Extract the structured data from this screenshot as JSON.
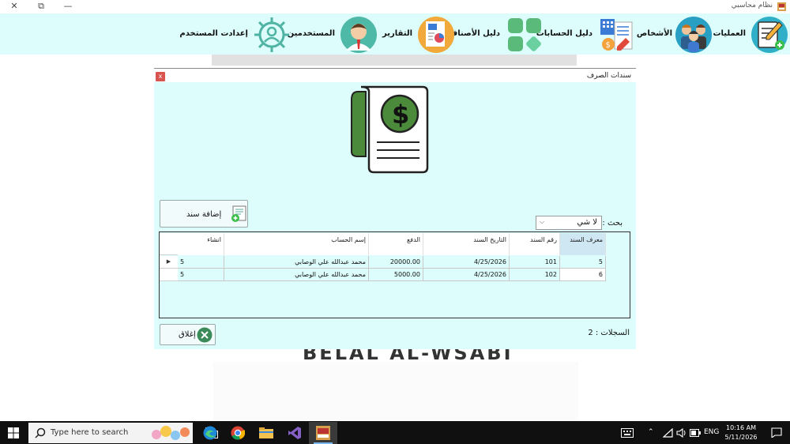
{
  "app": {
    "title": "نظام محاسبي",
    "window_controls": {
      "close": "✕",
      "restore": "⧉",
      "minimize": "—"
    }
  },
  "toolbar": {
    "items": [
      {
        "label": "العمليات",
        "icon": "document-edit-icon"
      },
      {
        "label": "الأشخاص",
        "icon": "people-icon"
      },
      {
        "label": "دليل الحسابات",
        "icon": "accounts-guide-icon"
      },
      {
        "label": "دليل الأصناف",
        "icon": "items-grid-icon"
      },
      {
        "label": "التقارير",
        "icon": "reports-icon"
      },
      {
        "label": "المستخدمين",
        "icon": "user-avatar-icon"
      },
      {
        "label": "إعدادت المستخدم",
        "icon": "user-settings-gear-icon"
      }
    ]
  },
  "background": {
    "brand_text": "BELAL AL-WSABI"
  },
  "dialog": {
    "title": "سندات الصرف",
    "close_label": "x",
    "add_button_label": "إضافة سند",
    "search_label": "بحث :",
    "search_value": "لا شي",
    "grid": {
      "columns": [
        "معرف السند",
        "رقم السند",
        "التاريخ السند",
        "الدفع",
        "إسم الحساب",
        "انشاء"
      ],
      "rows": [
        {
          "id": "5",
          "number": "101",
          "date": "4/25/2026",
          "payment": "20000.00",
          "account": "محمد عبدالله علي الوصابي",
          "created": "5",
          "selected": true
        },
        {
          "id": "6",
          "number": "102",
          "date": "4/25/2026",
          "payment": "5000.00",
          "account": "محمد عبدالله علي الوصابي",
          "created": "5",
          "selected": false
        }
      ]
    },
    "records_label": "السجلات : 2",
    "close_button_label": "إغلاق"
  },
  "taskbar": {
    "search_placeholder": "Type here to search",
    "language": "ENG",
    "time": "10:16 AM",
    "date": "5/11/2026"
  },
  "colors": {
    "toolbar_bg": "#dcfdfb",
    "row_selected": "#66c79d",
    "row_normal": "#0fcac3",
    "accent_green": "#3a8a3a"
  }
}
